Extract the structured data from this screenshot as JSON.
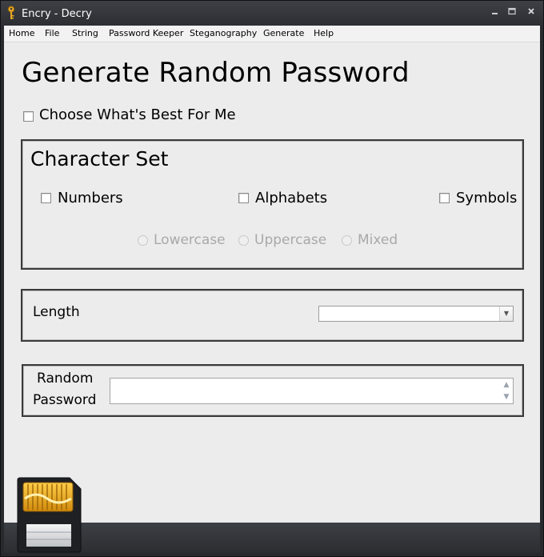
{
  "window": {
    "title": "Encry - Decry"
  },
  "menu": [
    "Home",
    "File",
    "String",
    "Password Keeper",
    "Steganography",
    "Generate",
    "Help"
  ],
  "page": {
    "title": "Generate Random Password",
    "auto_option_label": "Choose What's Best For Me"
  },
  "character_set": {
    "title": "Character Set",
    "numbers_label": "Numbers",
    "alphabets_label": "Alphabets",
    "symbols_label": "Symbols",
    "lowercase_label": "Lowercase",
    "uppercase_label": "Uppercase",
    "mixed_label": "Mixed"
  },
  "length": {
    "label": "Length",
    "value": ""
  },
  "random_password": {
    "label_line1": "Random",
    "label_line2": "Password",
    "value": ""
  },
  "icons": {
    "app": "key-icon",
    "logo": "sd-card-icon"
  },
  "colors": {
    "title_bar": "#2f3236",
    "content_bg": "#ececec",
    "group_border": "#3a3a3a",
    "disabled_text": "#a9a9a9"
  }
}
